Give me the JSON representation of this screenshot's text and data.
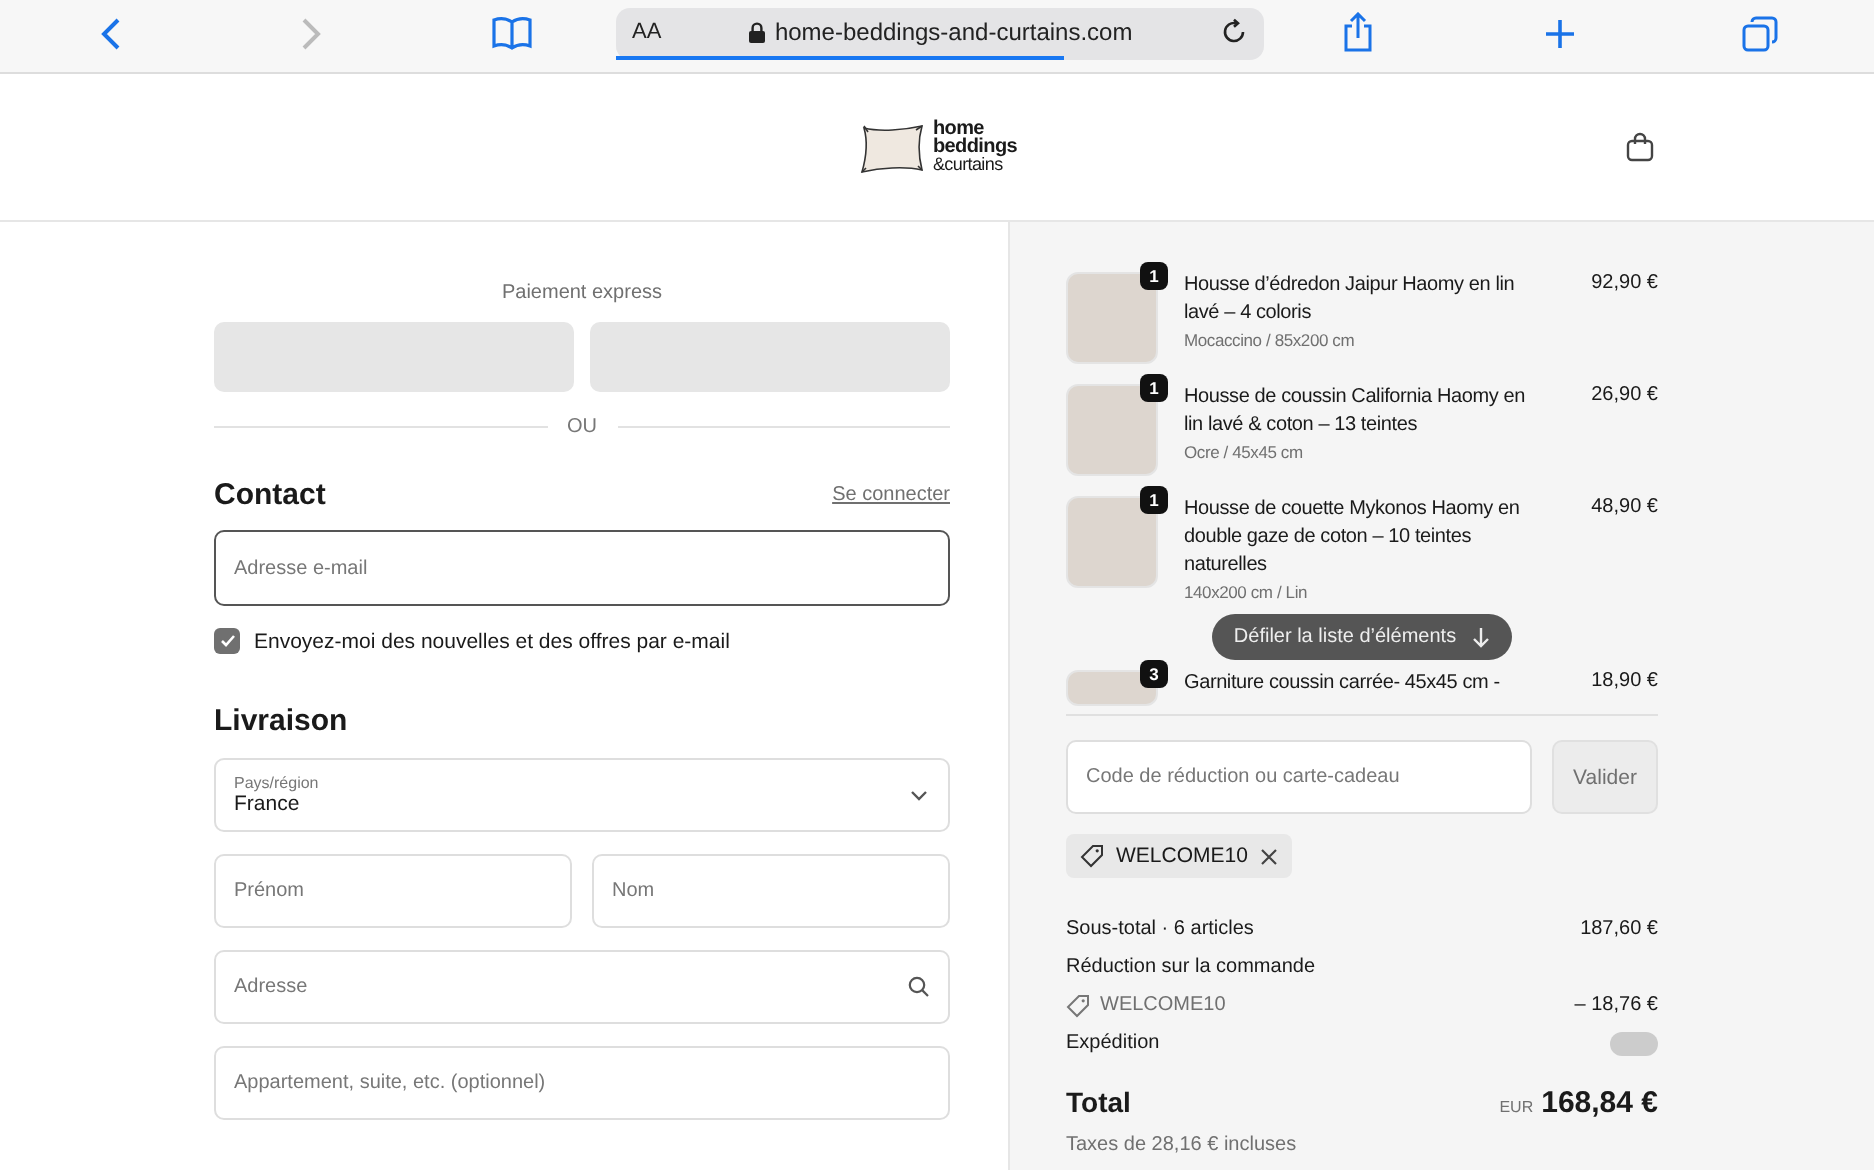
{
  "browser": {
    "text_size": "AA",
    "url": "home-beddings-and-curtains.com"
  },
  "header": {
    "logo_lines": [
      "home",
      "beddings",
      "&curtains"
    ]
  },
  "checkout": {
    "express_label": "Paiement express",
    "divider": "OU",
    "contact": {
      "heading": "Contact",
      "login_link": "Se connecter",
      "email_placeholder": "Adresse e-mail",
      "newsletter": {
        "label": "Envoyez-moi des nouvelles et des offres par e-mail",
        "checked": true
      }
    },
    "delivery": {
      "heading": "Livraison",
      "country": {
        "label": "Pays/région",
        "value": "France"
      },
      "fields": [
        {
          "kind": "pair",
          "placeholders": [
            "Prénom",
            "Nom"
          ]
        },
        {
          "kind": "search",
          "placeholders": [
            "Adresse"
          ]
        },
        {
          "kind": "single",
          "placeholders": [
            "Appartement, suite, etc. (optionnel)"
          ]
        }
      ]
    }
  },
  "summary": {
    "items": [
      {
        "quantity": "1",
        "title": "Housse d’édredon Jaipur Haomy en lin lavé – 4 coloris",
        "variant": "Mocaccino / 85x200 cm",
        "price": "92,90 €"
      },
      {
        "quantity": "1",
        "title": "Housse de coussin California Haomy en lin lavé & coton – 13 teintes",
        "variant": "Ocre / 45x45 cm",
        "price": "26,90 €"
      },
      {
        "quantity": "1",
        "title": "Housse de couette Mykonos Haomy en double gaze de coton – 10 teintes naturelles",
        "variant": "140x200 cm / Lin",
        "price": "48,90 €"
      },
      {
        "quantity": "3",
        "title": "Garniture coussin carrée- 45x45 cm -",
        "price": "18,90 €"
      }
    ],
    "scroll_hint": "Défiler la liste d’éléments",
    "discount": {
      "placeholder": "Code de réduction ou carte-cadeau",
      "button": "Valider"
    },
    "applied_code": "WELCOME10",
    "lines": [
      {
        "kind": "amount",
        "label": "Sous-total · 6 articles",
        "value": "187,60 €"
      },
      {
        "kind": "heading",
        "label": "Réduction sur la commande"
      },
      {
        "kind": "code",
        "label": "WELCOME10",
        "value": "– 18,76 €"
      },
      {
        "kind": "pending",
        "label": "Expédition"
      }
    ],
    "total": {
      "label": "Total",
      "currency": "EUR",
      "value": "168,84 €",
      "taxes": "Taxes de 28,16 € incluses"
    }
  }
}
